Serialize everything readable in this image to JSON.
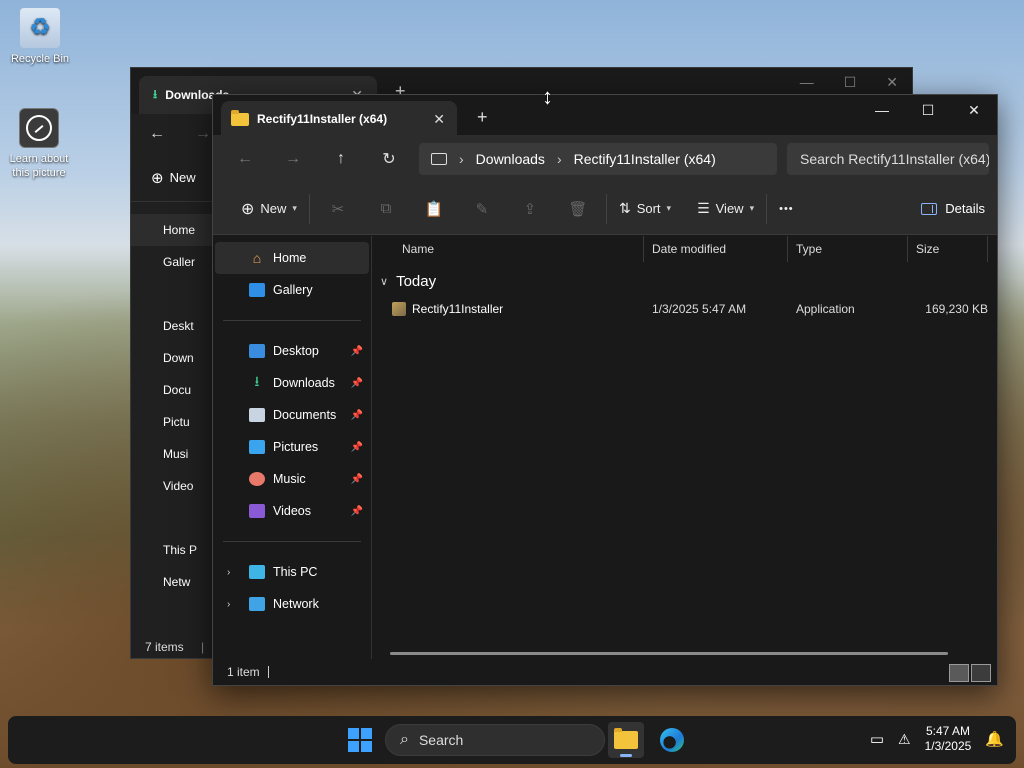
{
  "desktop": {
    "icons": [
      {
        "label": "Recycle Bin"
      },
      {
        "label": "Learn about this picture"
      }
    ]
  },
  "back_window": {
    "tab_title": "Downloads",
    "new_label": "New",
    "sidebar": [
      "Home",
      "Galler",
      "Deskt",
      "Down",
      "Docu",
      "Pictu",
      "Musi",
      "Video",
      "This P",
      "Netw"
    ],
    "status": "7 items",
    "status_sep": "1"
  },
  "window": {
    "tab_title": "Rectify11Installer (x64)",
    "address": {
      "segments": [
        "Downloads",
        "Rectify11Installer (x64)"
      ]
    },
    "search_placeholder": "Search Rectify11Installer (x64)",
    "commands": {
      "new": "New",
      "sort": "Sort",
      "view": "View",
      "more": "•••",
      "details": "Details"
    },
    "sidebar": {
      "top": [
        {
          "label": "Home",
          "icon": "home-icon",
          "selected": true
        },
        {
          "label": "Gallery",
          "icon": "gallery-icon"
        }
      ],
      "pinned": [
        {
          "label": "Desktop",
          "icon": "desktop-folder-icon"
        },
        {
          "label": "Downloads",
          "icon": "downloads-folder-icon"
        },
        {
          "label": "Documents",
          "icon": "documents-folder-icon"
        },
        {
          "label": "Pictures",
          "icon": "pictures-folder-icon"
        },
        {
          "label": "Music",
          "icon": "music-folder-icon"
        },
        {
          "label": "Videos",
          "icon": "videos-folder-icon"
        }
      ],
      "bottom": [
        {
          "label": "This PC",
          "icon": "this-pc-icon"
        },
        {
          "label": "Network",
          "icon": "network-icon"
        }
      ]
    },
    "columns": [
      "Name",
      "Date modified",
      "Type",
      "Size"
    ],
    "group_label": "Today",
    "files": [
      {
        "name": "Rectify11Installer",
        "date": "1/3/2025 5:47 AM",
        "type": "Application",
        "size": "169,230 KB"
      }
    ],
    "status": "1 item"
  },
  "taskbar": {
    "search_label": "Search",
    "time": "5:47 AM",
    "date": "1/3/2025"
  },
  "colors": {
    "accent": "#3da2ff",
    "window_bg": "#191919",
    "toolbar_bg": "#2c2c2c"
  }
}
